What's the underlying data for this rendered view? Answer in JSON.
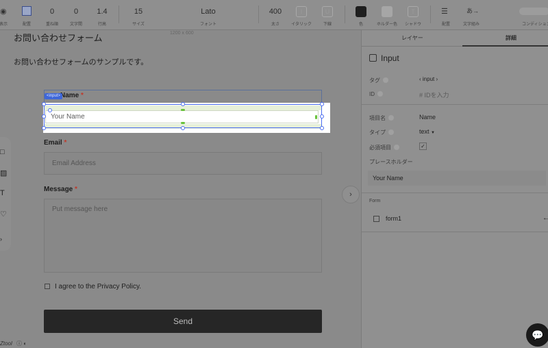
{
  "toolbar": {
    "items": [
      {
        "value": "",
        "label": "表示"
      },
      {
        "value": "",
        "label": "配置"
      },
      {
        "value": "0",
        "label": "重ね順"
      },
      {
        "value": "0",
        "label": "文字間"
      },
      {
        "value": "1.4",
        "label": "行高"
      },
      {
        "value": "15",
        "label": "サイズ"
      },
      {
        "value": "Lato",
        "label": "フォント"
      },
      {
        "value": "400",
        "label": "太さ"
      },
      {
        "value": "I",
        "label": "イタリック"
      },
      {
        "value": "U",
        "label": "下線"
      },
      {
        "value": "",
        "label": "色"
      },
      {
        "value": "",
        "label": "ホルダー色"
      },
      {
        "value": "T",
        "label": "シャドウ"
      },
      {
        "value": "",
        "label": "配置"
      },
      {
        "value": "",
        "label": "文字組み"
      },
      {
        "value": "",
        "label": "コンディション"
      }
    ]
  },
  "canvas": {
    "size_label": "1200 x 600",
    "page_title": "お問い合わせフォーム",
    "page_description": "お問い合わせフォームのサンプルです。",
    "selected_chip": "<input>",
    "fields": {
      "name_label": "Name",
      "name_placeholder": "Your Name",
      "email_label": "Email",
      "email_placeholder": "Email Address",
      "message_label": "Message",
      "message_placeholder": "Put message here",
      "required_mark": "*"
    },
    "agree_text": "I agree to the Privacy Policy.",
    "send_label": "Send",
    "logo_text": "Ztool"
  },
  "panel": {
    "tab_layers": "レイヤー",
    "tab_details": "詳細",
    "title": "Input",
    "tag_label": "タグ",
    "tag_value": "‹ input ›",
    "id_label": "ID",
    "id_placeholder": "# IDを入力",
    "item_name_label": "項目名",
    "item_name_value": "Name",
    "type_label": "タイプ",
    "type_value": "text",
    "required_label": "必須項目",
    "placeholder_label": "プレースホルダー",
    "placeholder_value": "Your Name",
    "form_section_label": "Form",
    "form_item": "form1"
  },
  "colors": {
    "selection": "#4a6cf0",
    "highlight_green": "#67c23a",
    "send_bg": "#262626"
  }
}
